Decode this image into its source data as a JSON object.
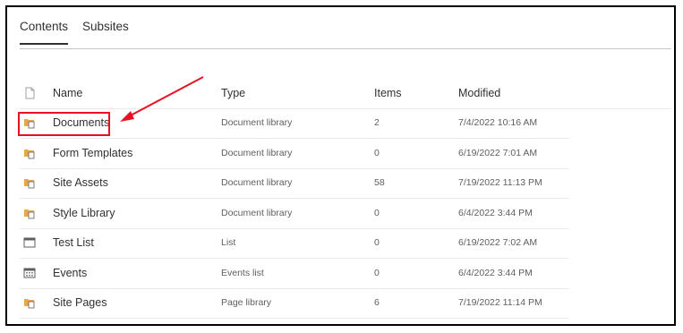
{
  "tabs": [
    {
      "label": "Contents",
      "active": true
    },
    {
      "label": "Subsites",
      "active": false
    }
  ],
  "columns": {
    "name": "Name",
    "type": "Type",
    "items": "Items",
    "modified": "Modified"
  },
  "rows": [
    {
      "name": "Documents",
      "type": "Document library",
      "items": "2",
      "modified": "7/4/2022 10:16 AM",
      "icon": "document-library-icon"
    },
    {
      "name": "Form Templates",
      "type": "Document library",
      "items": "0",
      "modified": "6/19/2022 7:01 AM",
      "icon": "document-library-icon"
    },
    {
      "name": "Site Assets",
      "type": "Document library",
      "items": "58",
      "modified": "7/19/2022 11:13 PM",
      "icon": "document-library-icon"
    },
    {
      "name": "Style Library",
      "type": "Document library",
      "items": "0",
      "modified": "6/4/2022 3:44 PM",
      "icon": "document-library-icon"
    },
    {
      "name": "Test List",
      "type": "List",
      "items": "0",
      "modified": "6/19/2022 7:02 AM",
      "icon": "list-icon"
    },
    {
      "name": "Events",
      "type": "Events list",
      "items": "0",
      "modified": "6/4/2022 3:44 PM",
      "icon": "calendar-icon"
    },
    {
      "name": "Site Pages",
      "type": "Page library",
      "items": "6",
      "modified": "7/19/2022 11:14 PM",
      "icon": "document-library-icon"
    }
  ],
  "colors": {
    "folder": "#e8a84a",
    "annotation": "#e81123",
    "frame": "#000000"
  }
}
